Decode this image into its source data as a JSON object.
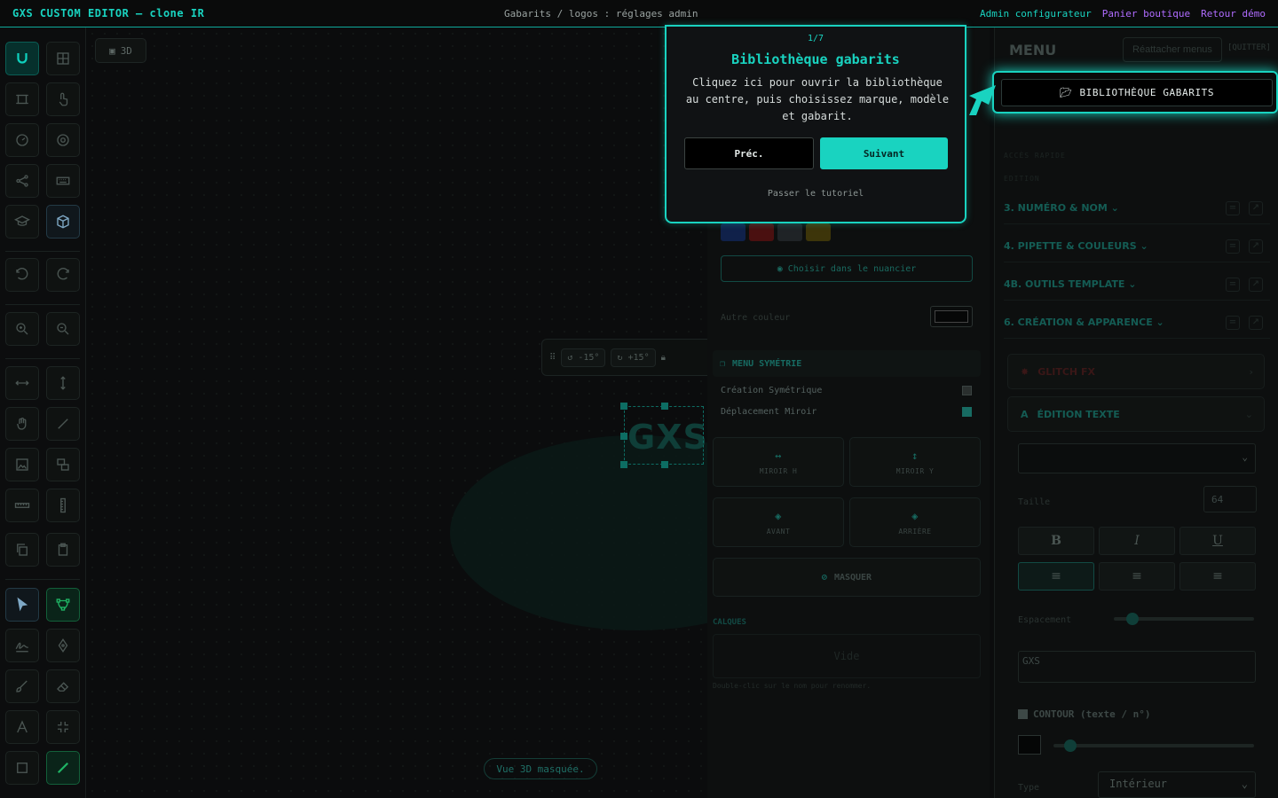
{
  "topbar": {
    "brand": "GXS CUSTOM EDITOR — clone IR",
    "breadcrumb": "Gabarits / logos : réglages admin",
    "links": [
      "Admin configurateur",
      "Panier boutique",
      "Retour démo"
    ]
  },
  "canvas": {
    "view_chip": "3D",
    "rotate_left": "-15°",
    "rotate_right": "+15°",
    "logo_text": "GXS",
    "vue3d_masquee": "Vue 3D masquée."
  },
  "middle_panel": {
    "choose_swatch": "Choisir dans le nuancier",
    "other_color": "Autre couleur",
    "symmetry_title": "MENU SYMÉTRIE",
    "rows": [
      {
        "label": "Création Symétrique",
        "checked": false
      },
      {
        "label": "Déplacement Miroir",
        "checked": true
      }
    ],
    "mirror_h": "MIROIR H",
    "mirror_v": "MIROIR Y",
    "avant": "AVANT",
    "arriere": "ARRIÈRE",
    "masquer": "MASQUER",
    "calques_title": "CALQUES",
    "vide": "Vide",
    "dbl_hint": "Double-clic sur le nom pour renommer.",
    "swatches": [
      "#1a3f8c",
      "#8c1a1a",
      "#3a3f44",
      "#7a6a14"
    ]
  },
  "right_panel": {
    "menu_title": "MENU",
    "reattach": "Réattacher menus",
    "quit": "[QUITTER]",
    "library_button": "BIBLIOTHÈQUE GABARITS",
    "acces_rapide": "ACCÈS RAPIDE",
    "edition": "EDITION",
    "accordions": [
      "3. NUMÉRO & NOM",
      "4. PIPETTE & COULEURS",
      "4B. OUTILS TEMPLATE",
      "6. CRÉATION & APPARENCE"
    ],
    "glitch": "GLITCH FX",
    "edition_texte": "ÉDITION TEXTE",
    "taille_label": "Taille",
    "taille_value": "64",
    "espacement_label": "Espacement",
    "espacement_value": 0.1,
    "text_value": "GXS",
    "contour_label": "CONTOUR (texte / n°)",
    "contour_value": 0.1,
    "type_label": "Type",
    "type_value": "Intérieur"
  },
  "tour": {
    "step": "1/7",
    "title": "Bibliothèque gabarits",
    "description": "Cliquez ici pour ouvrir la bibliothèque au centre, puis choisissez marque, modèle et gabarit.",
    "prev": "Préc.",
    "next": "Suivant",
    "skip": "Passer le tutoriel"
  },
  "colors": {
    "accent": "#19d3c0",
    "link_purple": "#b06cff",
    "bg": "#0b0c0d"
  }
}
